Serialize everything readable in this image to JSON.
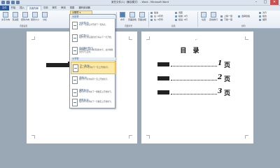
{
  "window": {
    "title": "某些文件(1)（兼容模式） - Word - Microsoft Word",
    "minimize": "–",
    "maximize": "□",
    "close": "✕"
  },
  "tabs": [
    "文件",
    "开始",
    "插入",
    "页面布局",
    "引用",
    "邮件",
    "审阅",
    "视图",
    "福昕阅读器"
  ],
  "ribbon": {
    "text_direction": "文字方向",
    "margins": "页边距",
    "orientation": "纸张方向",
    "size": "纸张大小",
    "columns": "分栏",
    "page_setup_group": "页面设置",
    "watermark": "水印",
    "page_color": "页面颜色",
    "page_border": "页面边框",
    "page_bg_group": "页面背景",
    "indent_label": "缩进",
    "indent_left": "左: 0字符",
    "indent_right": "右: 0字符",
    "spacing_label": "间距",
    "spacing_before": "段前: 0行",
    "spacing_after": "段后: 0行",
    "paragraph_group": "段落",
    "position": "位置",
    "wrap_text": "自动换行",
    "bring_forward": "上移一层",
    "send_backward": "下移一层",
    "selection_pane": "选择窗格",
    "align": "对齐",
    "group": "组合",
    "rotate": "旋转",
    "arrange_group": "排列"
  },
  "breaks_button": "分隔符",
  "breaks_menu": {
    "page_breaks_header": "分页符",
    "section_breaks_header": "分节符",
    "items": [
      {
        "title": "分页符(P)",
        "desc": "标记一页终止并开始下一页的点。",
        "highlight": false
      },
      {
        "title": "分栏符(C)",
        "desc": "指示分栏符后面的文字将从下一栏开始。",
        "highlight": false
      },
      {
        "title": "自动换行符(T)",
        "desc": "分隔网页上的对象周围的文字，如分隔题注文字与正文。",
        "highlight": false
      },
      {
        "title": "下一页(N)",
        "desc": "插入分节符并在下一页上开始新节。",
        "highlight": true
      },
      {
        "title": "连续(O)",
        "desc": "插入分节符并在同一页上开始新节。",
        "highlight": false
      },
      {
        "title": "偶数页(E)",
        "desc": "插入分节符并在下一偶数页上开始新节。",
        "highlight": false
      },
      {
        "title": "奇数页(D)",
        "desc": "插入分节符并在下一奇数页上开始新节。",
        "highlight": false
      }
    ]
  },
  "toc": {
    "title": "目 录",
    "entries": [
      {
        "num": "1",
        "page": "页"
      },
      {
        "num": "2",
        "page": "页"
      },
      {
        "num": "3",
        "page": "页"
      }
    ]
  },
  "paragraph_mark": "↵"
}
